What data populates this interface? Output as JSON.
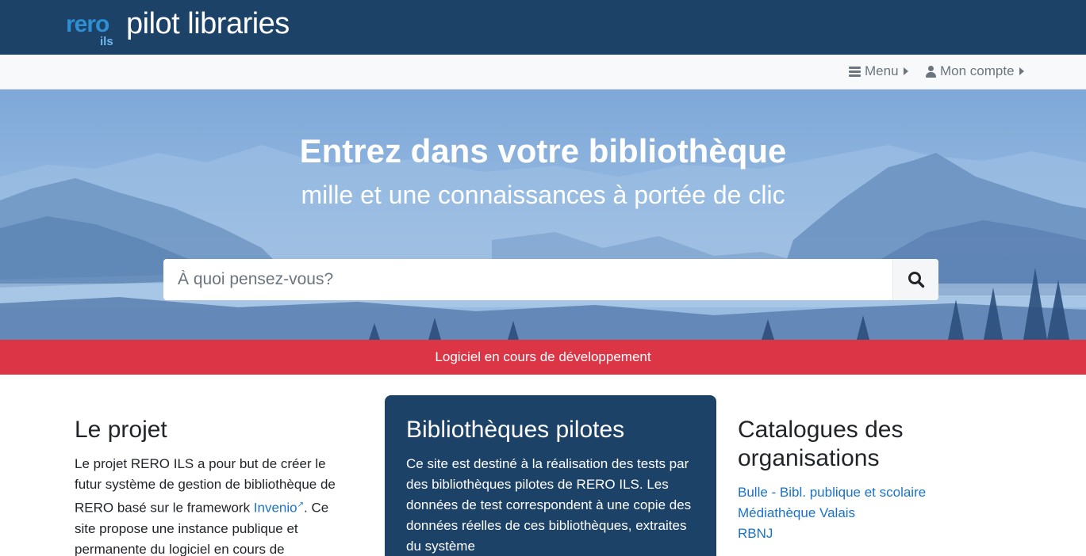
{
  "brand": {
    "logo_word": "rero",
    "logo_sub": "ils",
    "name": "pilot libraries"
  },
  "nav": {
    "menu_label": "Menu",
    "account_label": "Mon compte"
  },
  "hero": {
    "title": "Entrez dans votre bibliothèque",
    "subtitle": "mille et une connaissances à portée de clic",
    "search_placeholder": "À quoi pensez-vous?"
  },
  "banner": {
    "text": "Logiciel en cours de développement"
  },
  "project": {
    "title": "Le projet",
    "text_before_link": "Le projet RERO ILS a pour but de créer le futur système de gestion de bibliothèque de RERO basé sur le framework ",
    "link_label": "Invenio",
    "text_after_link": ". Ce site propose une instance publique et permanente du logiciel en cours de"
  },
  "pilots": {
    "title": "Bibliothèques pilotes",
    "text": "Ce site est destiné à la réalisation des tests par des bibliothèques pilotes de RERO ILS. Les données de test correspondent à une copie des données réelles de ces bibliothèques, extraites du système"
  },
  "catalogues": {
    "title": "Catalogues des organisations",
    "items": [
      {
        "label": "Bulle - Bibl. publique et scolaire"
      },
      {
        "label": "Médiathèque Valais"
      },
      {
        "label": "RBNJ"
      }
    ]
  },
  "icons": {
    "menu": "bars-icon",
    "account": "user-icon",
    "search": "search-icon",
    "external": "external-link-icon"
  },
  "colors": {
    "brand_navy": "#1d4268",
    "alert_red": "#dc3545",
    "link_blue": "#1a73c8"
  }
}
